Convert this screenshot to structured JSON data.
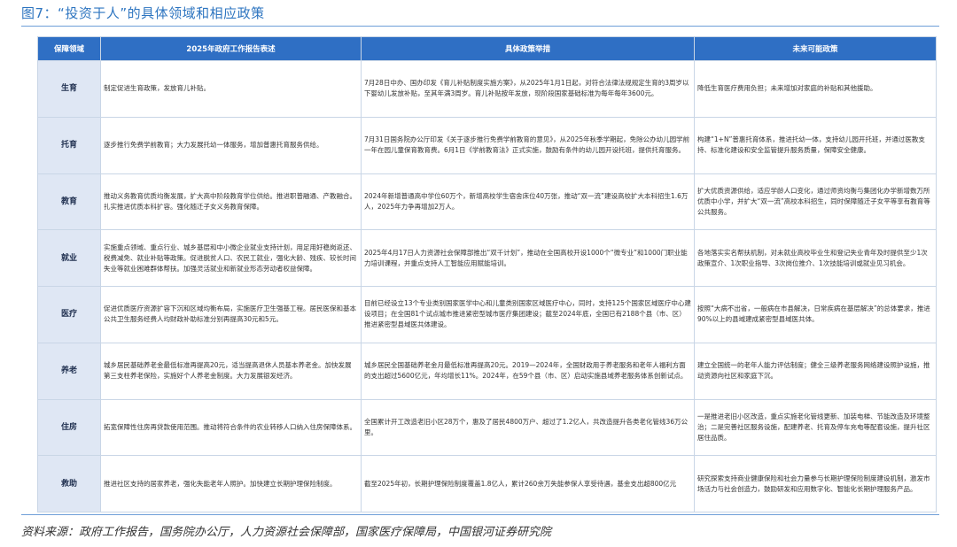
{
  "figure": {
    "title": "图7：“投资于人”的具体领域和相应政策",
    "source": "资料来源：政府工作报告，国务院办公厅，人力资源社会保障部，国家医疗保障局，中国银河证券研究院"
  },
  "table": {
    "headers": [
      "保障领域",
      "2025年政府工作报告表述",
      "具体政策举措",
      "未来可能政策"
    ],
    "rows": [
      {
        "area": "生育",
        "report": "制定促进生育政策，发放育儿补贴。",
        "measures": "7月28日中办、国办印发《育儿补贴制度实施方案》，从2025年1月1日起，对符合法律法规规定生育的3周岁以下婴幼儿发放补贴，至其年满3周岁。育儿补贴按年发放，现阶段国家基础标准为每年每年3600元。",
        "future": "降低生育医疗费用负担；未来增加对家庭的补贴和其他援助。"
      },
      {
        "area": "托育",
        "report": "逐步推行免费学前教育；大力发展托幼一体服务，增加普惠托育服务供给。",
        "measures": "7月31日国务院办公厅印发《关于逐步推行免费学前教育的意见》，从2025年秋季学期起，免除公办幼儿园学前一年在园儿童保育教育费。6月1日《学前教育法》正式实施，鼓励有条件的幼儿园开设托班，提供托育服务。",
        "future": "构建“1+N”普惠托育体系，推进托幼一体，支持幼儿园开托班，并通过医教支持、标准化建设和安全监管提升服务质量，保障安全健康。"
      },
      {
        "area": "教育",
        "report": "推动义务教育优质均衡发展，扩大高中阶段教育学位供给。推进职普融通、产教融合。扎实推进优质本科扩容。强化随迁子女义务教育保障。",
        "measures": "2024年新增普通高中学位60万个，新增高校学生宿舍床位40万张，推动“双一流”建设高校扩大本科招生1.6万人，2025年力争再增加2万人。",
        "future": "扩大优质资源供给，适应学龄人口变化，通过师资均衡与集团化办学新增数万所优质中小学，并扩大“双一流”高校本科招生，同时保障随迁子女平等享有教育等公共服务。"
      },
      {
        "area": "就业",
        "report": "实施重点领域、重点行业、城乡基层和中小微企业就业支持计划，用足用好稳岗返还、税费减免、就业补贴等政策。促进脱贫人口、农民工就业，强化大龄、残疾、较长时间失业等就业困难群体帮扶。加强灵活就业和新就业形态劳动者权益保障。",
        "measures": "2025年4月17日人力资源社会保障部推出“双千计划”，推动在全国高校开设1000个“微专业”和1000门职业能力培训课程，并重点支持人工智能应用赋能培训。",
        "future": "各地落实实名帮扶机制，对未就业高校毕业生和登记失业青年及时提供至少1次政策宣介、1次职业指导、3次岗位推介、1次技能培训或就业见习机会。"
      },
      {
        "area": "医疗",
        "report": "促进优质医疗资源扩容下沉和区域均衡布局，实施医疗卫生强基工程。居民医保和基本公共卫生服务经费人均财政补助标准分别再提高30元和5元。",
        "measures": "目前已经设立13个专业类别国家医学中心和儿童类别国家区域医疗中心，同时，支持125个国家区域医疗中心建设项目；在全国81个试点城市推进紧密型城市医疗集团建设；截至2024年底，全国已有2188个县（市、区）推进紧密型县域医共体建设。",
        "future": "按照“大病不出省，一般病在市县解决，日常疾病在基层解决”的总体要求，推进90%以上的县域建成紧密型县域医共体。"
      },
      {
        "area": "养老",
        "report": "城乡居民基础养老金最低标准再提高20元，适当提高退休人员基本养老金。加快发展第三支柱养老保险，实施好个人养老金制度。大力发展银发经济。",
        "measures": "城乡居民全国基础养老金月最低标准再提高20元。2019—2024年，全国财政用于养老服务和老年人福利方面的支出超过5600亿元，年均增长11%。2024年，在59个县（市、区）启动实施县域养老服务体系创新试点。",
        "future": "建立全国统一的老年人能力评估制度；健全三级养老服务网络建设照护设施，推动资源向社区和家庭下沉。"
      },
      {
        "area": "住房",
        "report": "拓宽保障性住房再贷款使用范围。推动将符合条件的农业转移人口纳入住房保障体系。",
        "measures": "全国累计开工改造老旧小区28万个，惠及了居民4800万户、超过了1.2亿人，共改造提升各类老化管线36万公里。",
        "future": "一是推进老旧小区改造，重点实施老化管线更新、加装电梯、节能改造及环境整治；二是完善社区服务设施，配建养老、托育及停车充电等配套设施，提升社区居住品质。"
      },
      {
        "area": "救助",
        "report": "推进社区支持的居家养老，强化失能老年人照护。加快建立长期护理保险制度。",
        "measures": "截至2025年初，长期护理保险制度覆盖1.8亿人，累计260余万失能参保人享受待遇，基金支出超800亿元",
        "future": "研究探索支持商业健康保险和社会力量参与长期护理保险制度建设机制，激发市场活力与社会创造力，鼓励研发和应用数字化、智能化长期护理服务产品。"
      }
    ]
  }
}
